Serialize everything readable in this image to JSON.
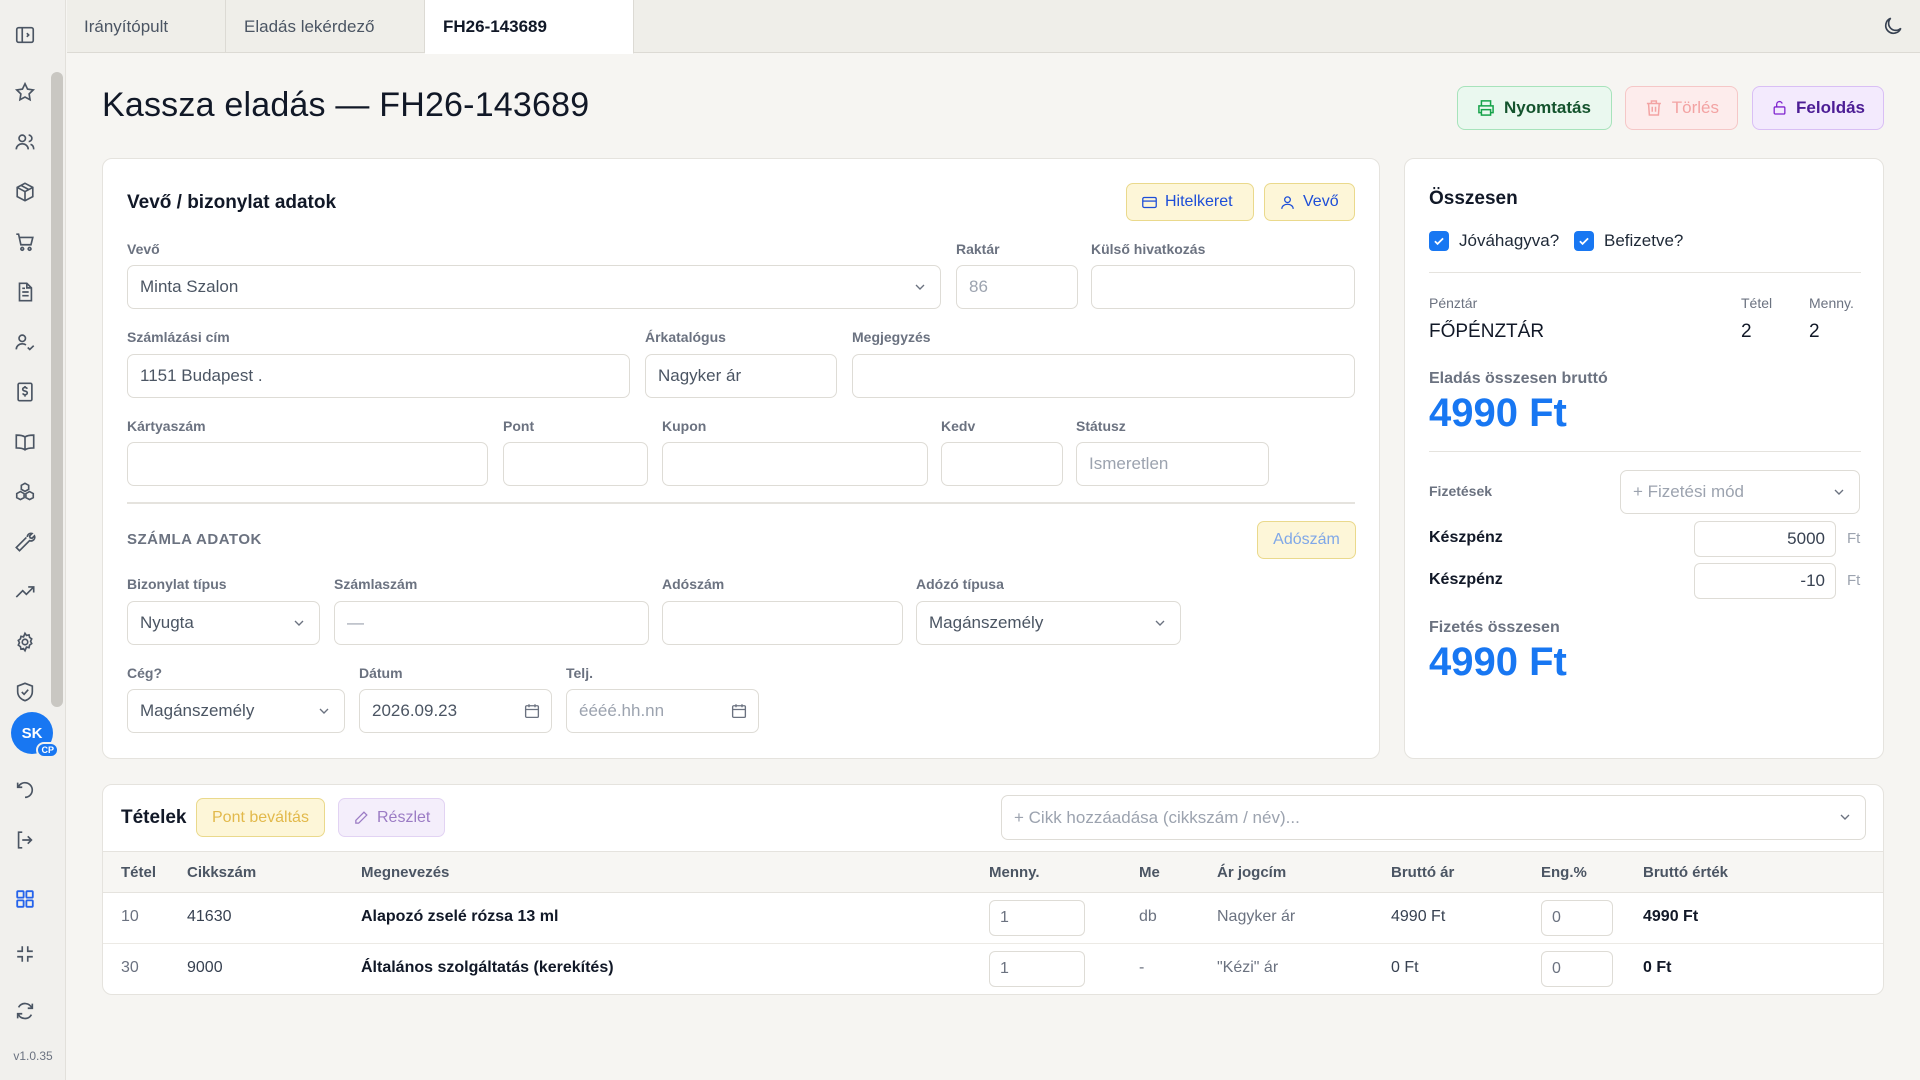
{
  "app": {
    "version": "v1.0.35",
    "user_initials": "SK",
    "user_badge": "CP"
  },
  "tabs": [
    {
      "label": "Irányítópult",
      "active": false
    },
    {
      "label": "Eladás lekérdező",
      "active": false
    },
    {
      "label": "FH26-143689",
      "active": true
    }
  ],
  "sidebar": {
    "icons": [
      "panel-toggle-icon",
      "star-icon",
      "users-icon",
      "box-icon",
      "cart-icon",
      "document-icon",
      "user-check-icon",
      "invoice-icon",
      "book-icon",
      "boxes-icon",
      "wrench-icon",
      "trend-icon",
      "gear-icon",
      "shield-icon",
      "undo-icon",
      "logout-icon",
      "grid-icon",
      "collapse-icon",
      "refresh-icon"
    ]
  },
  "header": {
    "title": "Kassza eladás — FH26-143689",
    "print_label": "Nyomtatás",
    "delete_label": "Törlés",
    "unlock_label": "Feloldás"
  },
  "customer": {
    "title": "Vevő / bizonylat adatok",
    "credit_btn": "Hitelkeret",
    "customer_btn": "Vevő",
    "labels": {
      "customer": "Vevő",
      "warehouse": "Raktár",
      "ext_ref": "Külső hivatkozás",
      "billing": "Számlázási cím",
      "catalog": "Árkatalógus",
      "note": "Megjegyzés",
      "card": "Kártyaszám",
      "points": "Pont",
      "coupon": "Kupon",
      "discount": "Kedv",
      "status": "Státusz"
    },
    "values": {
      "customer": "Minta Szalon",
      "warehouse": "86",
      "ext_ref": "",
      "billing": "1151 Budapest .",
      "catalog": "Nagyker ár",
      "note": "",
      "card": "",
      "points": "",
      "coupon": "",
      "discount": "",
      "status": "Ismeretlen"
    }
  },
  "invoice": {
    "section": "SZÁMLA ADATOK",
    "tax_btn": "Adószám",
    "labels": {
      "doc_type": "Bizonylat típus",
      "invoice_no": "Számlaszám",
      "tax_no": "Adószám",
      "taxpayer_type": "Adózó típusa",
      "company": "Cég?",
      "date": "Dátum",
      "fulfil": "Telj."
    },
    "values": {
      "doc_type": "Nyugta",
      "invoice_no": "—",
      "tax_no": "",
      "taxpayer_type": "Magánszemély",
      "company": "Magánszemély",
      "date": "2026.09.23",
      "fulfil_placeholder": "éééé.hh.nn"
    }
  },
  "summary": {
    "title": "Összesen",
    "approved_label": "Jóváhagyva?",
    "approved": true,
    "paid_label": "Befizetve?",
    "paid": true,
    "register_label": "Pénztár",
    "register": "FŐPÉNZTÁR",
    "items_label": "Tétel",
    "items": "2",
    "qty_label": "Menny.",
    "qty": "2",
    "gross_label": "Eladás összesen bruttó",
    "gross": "4990 Ft",
    "payments_label": "Fizetések",
    "payment_method_placeholder": "+ Fizetési mód",
    "payments": [
      {
        "label": "Készpénz",
        "amount": "5000",
        "unit": "Ft"
      },
      {
        "label": "Készpénz",
        "amount": "-10",
        "unit": "Ft"
      }
    ],
    "pay_total_label": "Fizetés összesen",
    "pay_total": "4990 Ft"
  },
  "items": {
    "title": "Tételek",
    "points_btn": "Pont beváltás",
    "detail_btn": "Részlet",
    "add_placeholder": "+ Cikk hozzáadása (cikkszám / név)...",
    "columns": [
      "Tétel",
      "Cikkszám",
      "Megnevezés",
      "Menny.",
      "Me",
      "Ár jogcím",
      "Bruttó ár",
      "Eng.%",
      "Bruttó érték"
    ],
    "rows": [
      {
        "pos": "10",
        "sku": "41630",
        "name": "Alapozó zselé rózsa 13 ml",
        "qty": "1",
        "unit": "db",
        "price_type": "Nagyker ár",
        "price": "4990 Ft",
        "disc": "0",
        "value": "4990 Ft"
      },
      {
        "pos": "30",
        "sku": "9000",
        "name": "Általános szolgáltatás (kerekítés)",
        "qty": "1",
        "unit": "-",
        "price_type": "\"Kézi\" ár",
        "price": "0 Ft",
        "disc": "0",
        "value": "0 Ft"
      }
    ]
  },
  "colors": {
    "accent": "#1877f2",
    "print_border": "#a7e3bb",
    "unlock_border": "#d9bff5",
    "delete_border": "#f5c7c7"
  }
}
